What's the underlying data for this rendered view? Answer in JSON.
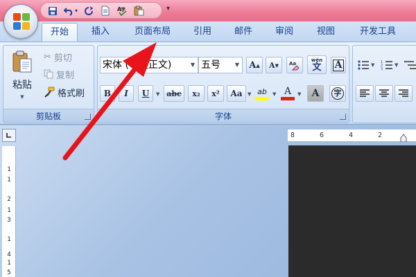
{
  "tabs": [
    "开始",
    "插入",
    "页面布局",
    "引用",
    "邮件",
    "审阅",
    "视图",
    "开发工具"
  ],
  "active_tab": "开始",
  "qat": {
    "icons": [
      "save-icon",
      "undo-icon",
      "redo-icon",
      "new-document-icon",
      "spelling-icon",
      "paste-icon"
    ],
    "more": "▾"
  },
  "clipboard": {
    "paste": "粘贴",
    "cut": "剪切",
    "copy": "复制",
    "format_painter": "格式刷",
    "label": "剪贴板"
  },
  "font": {
    "face": "宋体 (中文正文)",
    "size": "五号",
    "label": "字体",
    "grow": "A",
    "shrink": "A",
    "phonetic": "wén",
    "phonetic_char": "文",
    "border_char": "A",
    "bold": "B",
    "italic": "I",
    "underline": "U",
    "strike": "abc",
    "subscript": "x₂",
    "superscript": "x²",
    "case": "Aa",
    "highlight": "ab",
    "font_color": "A",
    "shading": "A",
    "enclose": "字"
  },
  "colors": {
    "highlight": "#ffff00",
    "font_color": "#e02020",
    "annotation_arrow": "#e8141b",
    "titlebar": "#ec7a97"
  },
  "rulers": {
    "vertical": [
      "1",
      "1",
      "2",
      "1",
      "3",
      "1",
      "4",
      "1",
      "5"
    ],
    "horizontal": [
      "8",
      "6",
      "4",
      "2"
    ]
  }
}
